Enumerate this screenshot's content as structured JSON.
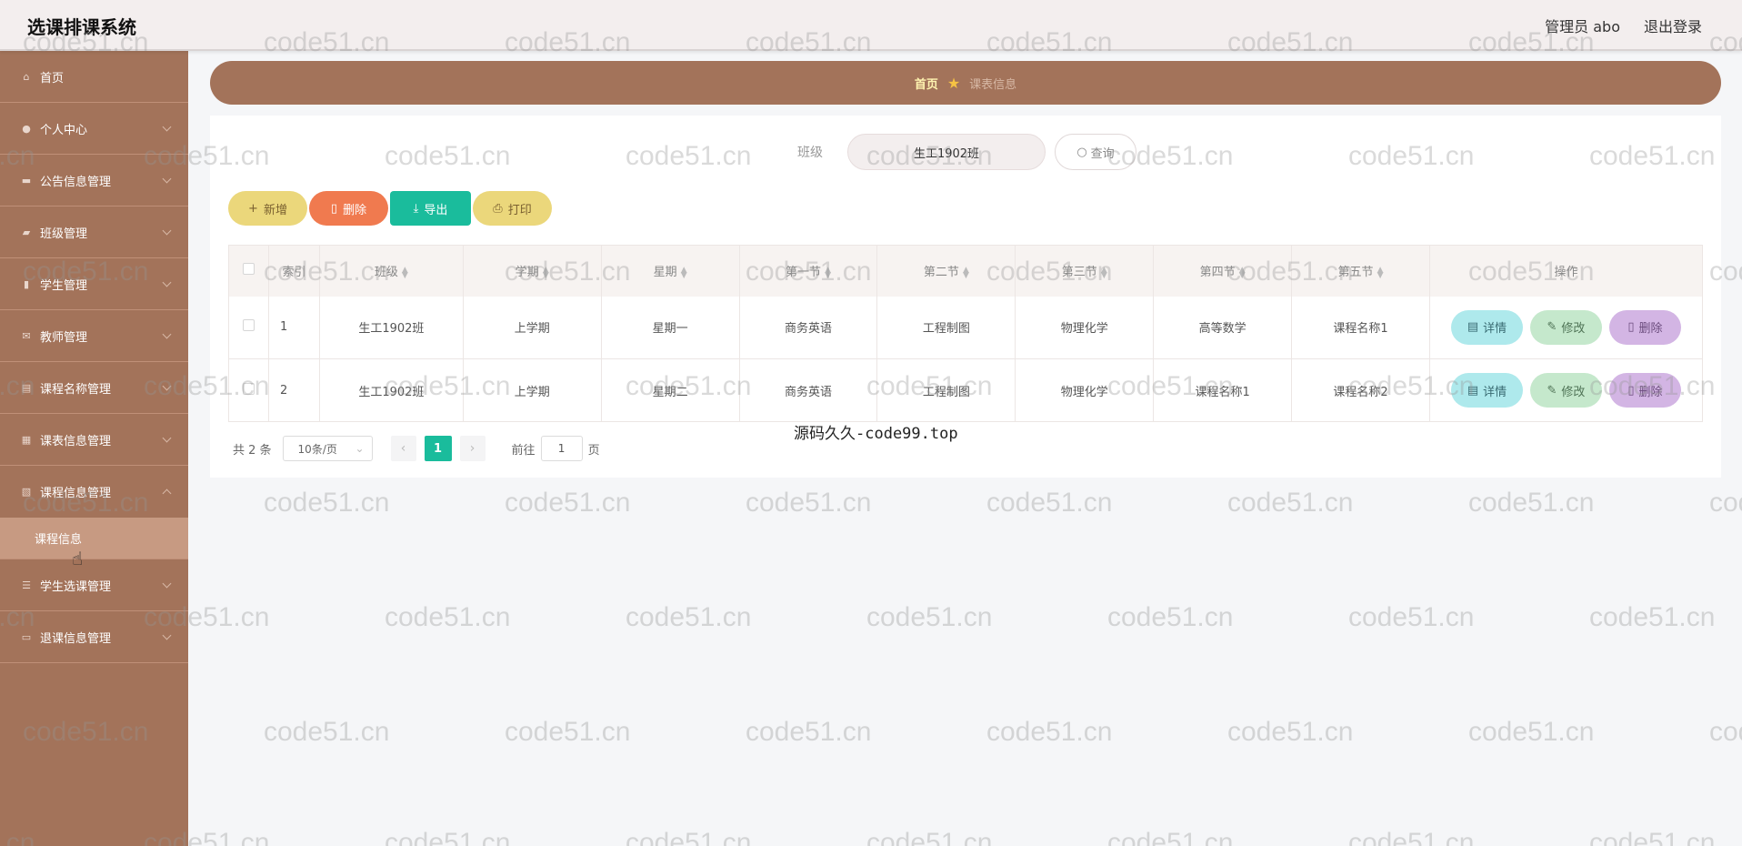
{
  "header": {
    "app_title": "选课排课系统",
    "user_label": "管理员 abo",
    "logout_label": "退出登录"
  },
  "sidebar": {
    "items": [
      {
        "label": "首页",
        "icon": "home-icon"
      },
      {
        "label": "个人中心",
        "icon": "user-icon"
      },
      {
        "label": "公告信息管理",
        "icon": "notice-icon"
      },
      {
        "label": "班级管理",
        "icon": "class-icon"
      },
      {
        "label": "学生管理",
        "icon": "chart-icon"
      },
      {
        "label": "教师管理",
        "icon": "teacher-icon"
      },
      {
        "label": "课程名称管理",
        "icon": "course-icon"
      },
      {
        "label": "课表信息管理",
        "icon": "schedule-icon"
      },
      {
        "label": "课程信息管理",
        "icon": "info-icon"
      },
      {
        "label": "学生选课管理",
        "icon": "select-icon"
      },
      {
        "label": "退课信息管理",
        "icon": "drop-icon"
      }
    ],
    "submenu_label": "课程信息"
  },
  "breadcrumb": {
    "home": "首页",
    "current": "课表信息"
  },
  "search": {
    "label": "班级",
    "value": "生工1902班",
    "button_label": "查询"
  },
  "toolbar": {
    "add_label": "新增",
    "delete_label": "删除",
    "export_label": "导出",
    "print_label": "打印"
  },
  "table": {
    "columns": [
      "索引",
      "班级",
      "学期",
      "星期",
      "第一节",
      "第二节",
      "第三节",
      "第四节",
      "第五节",
      "操作"
    ],
    "rows": [
      {
        "index": "1",
        "class": "生工1902班",
        "term": "上学期",
        "weekday": "星期一",
        "p1": "商务英语",
        "p2": "工程制图",
        "p3": "物理化学",
        "p4": "高等数学",
        "p5": "课程名称1"
      },
      {
        "index": "2",
        "class": "生工1902班",
        "term": "上学期",
        "weekday": "星期二",
        "p1": "商务英语",
        "p2": "工程制图",
        "p3": "物理化学",
        "p4": "课程名称1",
        "p5": "课程名称2"
      }
    ],
    "row_actions": {
      "detail": "详情",
      "edit": "修改",
      "delete": "删除"
    }
  },
  "pagination": {
    "total": "共 2 条",
    "page_size": "10条/页",
    "current_page": "1",
    "goto_label": "前往",
    "goto_value": "1",
    "page_unit": "页"
  },
  "caption": "源码久久-code99.top",
  "watermark": "code51.cn",
  "colors": {
    "sidebar": "#a3735a",
    "accent": "#1abc9c",
    "delete": "#f07a4f",
    "yellow": "#ebd77b"
  }
}
